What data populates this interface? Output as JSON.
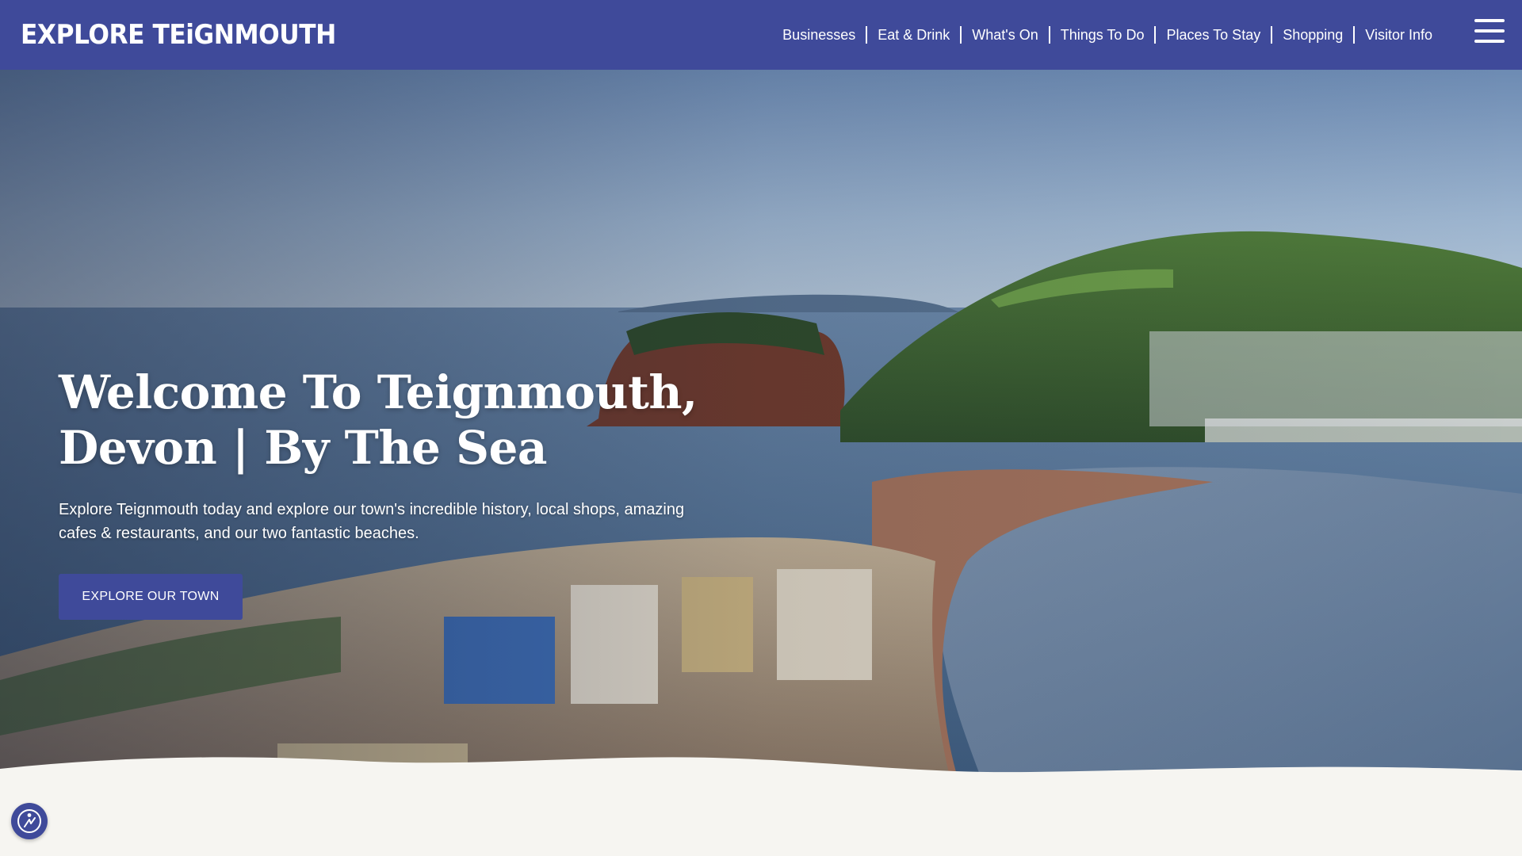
{
  "header": {
    "logo_text": "EXPLORE TEiGNMOUTH",
    "nav": [
      {
        "label": "Businesses"
      },
      {
        "label": "Eat & Drink"
      },
      {
        "label": "What's On"
      },
      {
        "label": "Things To Do"
      },
      {
        "label": "Places To Stay"
      },
      {
        "label": "Shopping"
      },
      {
        "label": "Visitor Info"
      }
    ],
    "menu_icon": "hamburger-menu-icon"
  },
  "hero": {
    "title_line1": "Welcome To Teignmouth,",
    "title_line2": "Devon | By The Sea",
    "description": "Explore Teignmouth today and explore our town's incredible history, local shops, amazing cafes & restaurants, and our two fantastic beaches.",
    "button_label": "EXPLORE OUR TOWN"
  },
  "accessibility": {
    "icon": "accessibility-icon"
  },
  "colors": {
    "brand": "#3f4a9a",
    "page_background": "#f6f5f1",
    "text_on_brand": "#ffffff"
  }
}
